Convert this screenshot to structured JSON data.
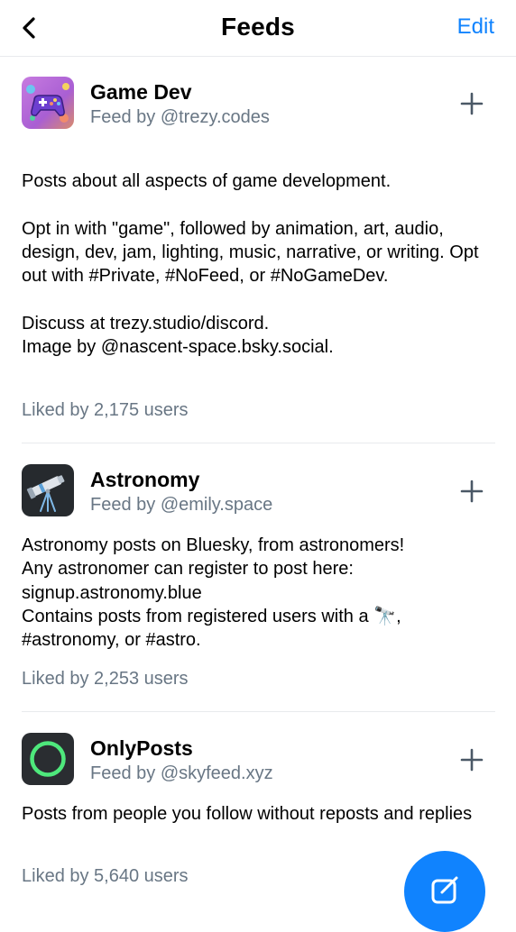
{
  "header": {
    "title": "Feeds",
    "edit_label": "Edit"
  },
  "feeds": [
    {
      "name": "Game Dev",
      "by": "Feed by @trezy.codes",
      "description": "Posts about all aspects of game development.\n\nOpt in with \"game\", followed by animation, art, audio, design, dev, jam, lighting, music, narrative, or writing. Opt out with #Private, #NoFeed, or #NoGameDev.\n\nDiscuss at trezy.studio/discord.\nImage by @nascent-space.bsky.social.",
      "likes": "Liked by 2,175 users",
      "icon": "game-controller-icon"
    },
    {
      "name": "Astronomy",
      "by": "Feed by @emily.space",
      "description": "Astronomy posts on Bluesky, from astronomers!\nAny astronomer can register to post here:\nsignup.astronomy.blue\nContains posts from registered users with a 🔭,\n#astronomy, or #astro.",
      "likes": "Liked by 2,253 users",
      "icon": "telescope-icon"
    },
    {
      "name": "OnlyPosts",
      "by": "Feed by @skyfeed.xyz",
      "description": "Posts from people you follow without reposts and replies",
      "likes": "Liked by 5,640 users",
      "icon": "green-ring-icon"
    }
  ],
  "colors": {
    "accent": "#1083fe",
    "muted": "#687684",
    "divider": "#e8eaed"
  }
}
